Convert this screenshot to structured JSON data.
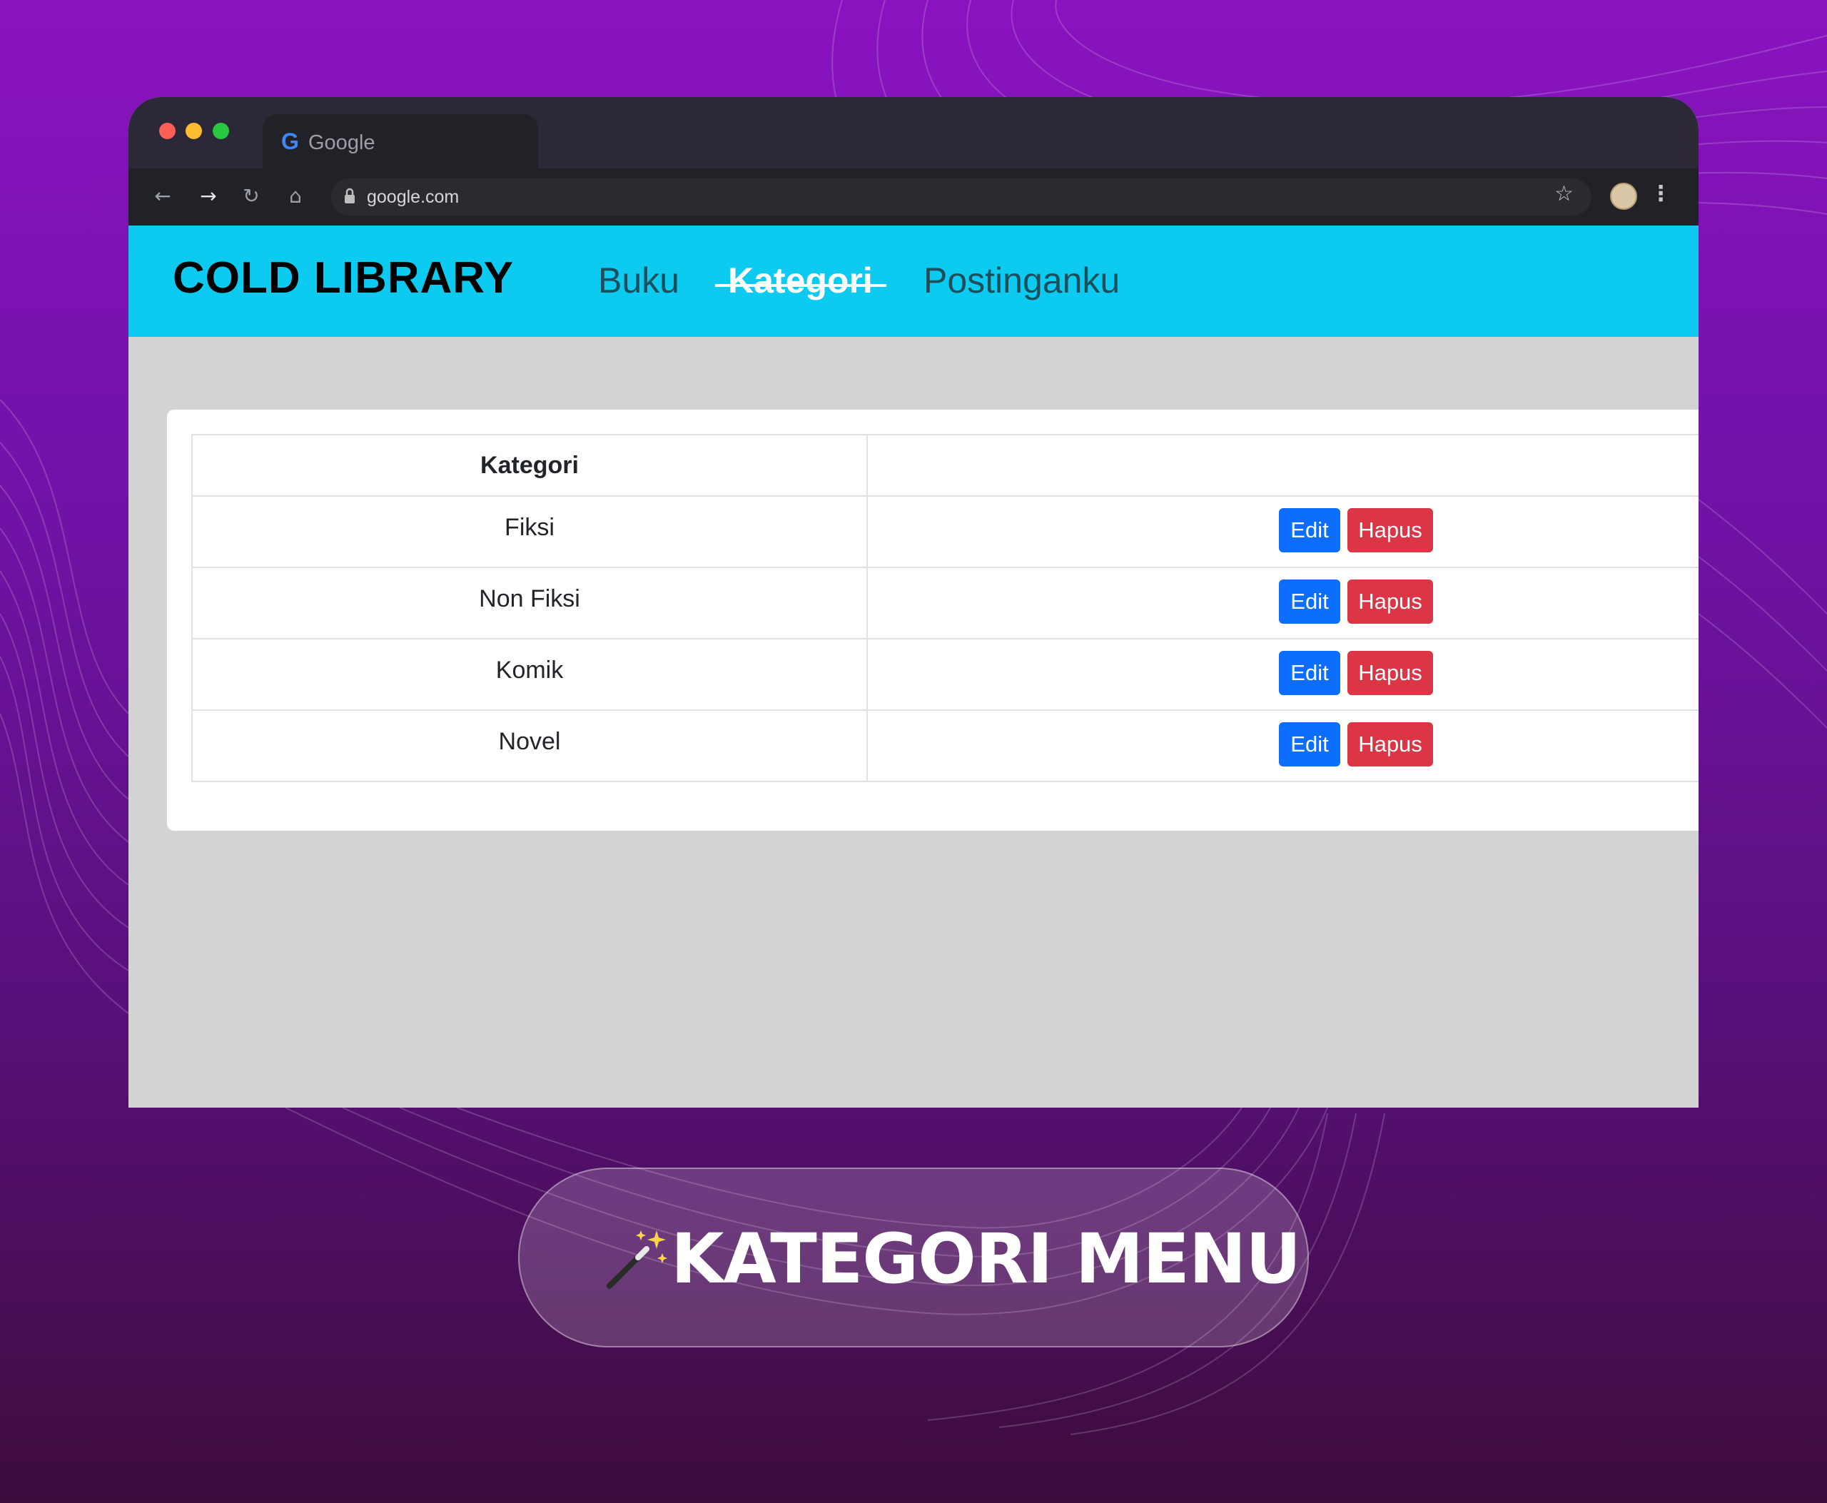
{
  "browser": {
    "tab_title": "Google",
    "tab_favicon": "google-g-icon",
    "url": "google.com",
    "colors": {
      "titlebar": "#2d2838",
      "toolbar": "#212228"
    }
  },
  "navbar": {
    "brand": "COLD LIBRARY",
    "links": [
      {
        "label": "Buku",
        "active": false
      },
      {
        "label": "Kategori",
        "active": true
      },
      {
        "label": "Postinganku",
        "active": false
      }
    ],
    "colors": {
      "background": "#0dcaf0",
      "active": "#ffffff"
    }
  },
  "table": {
    "headers": [
      "Kategori",
      ""
    ],
    "rows": [
      {
        "kategori": "Fiksi",
        "edit": "Edit",
        "hapus": "Hapus"
      },
      {
        "kategori": "Non Fiksi",
        "edit": "Edit",
        "hapus": "Hapus"
      },
      {
        "kategori": "Komik",
        "edit": "Edit",
        "hapus": "Hapus"
      },
      {
        "kategori": "Novel",
        "edit": "Edit",
        "hapus": "Hapus"
      }
    ],
    "colors": {
      "edit": "#0d6efd",
      "hapus": "#dc3545"
    }
  },
  "caption": {
    "icon": "magic-wand-icon",
    "text": "KATEGORI MENU"
  }
}
